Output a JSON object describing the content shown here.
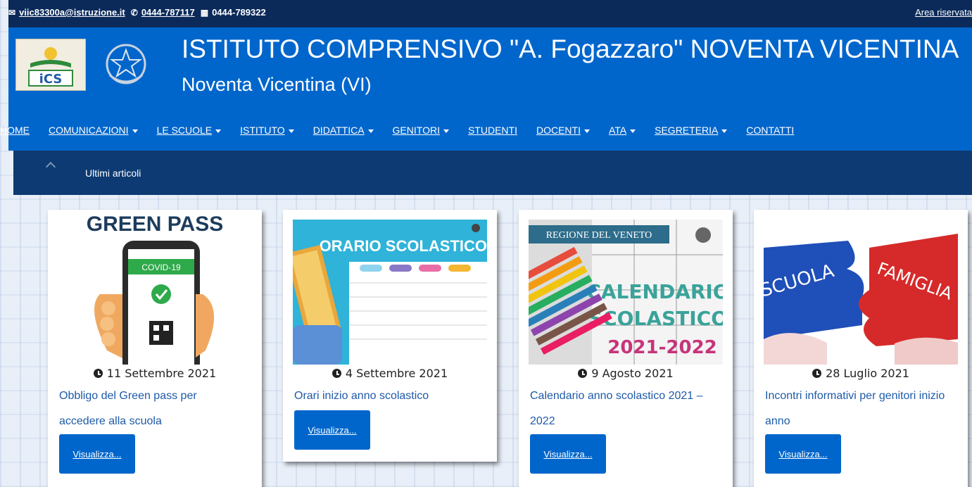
{
  "topbar": {
    "email": "viic83300a@istruzione.it",
    "phone": "0444-787117",
    "fax": "0444-789322",
    "reserved_area": "Area riservata"
  },
  "header": {
    "title": "ISTITUTO COMPRENSIVO \"A. Fogazzaro\" NOVENTA VICENTINA",
    "subtitle": "Noventa Vicentina (VI)",
    "logo_text": "iCS"
  },
  "nav": {
    "items": [
      {
        "label": "HOME",
        "dropdown": false
      },
      {
        "label": "COMUNICAZIONI",
        "dropdown": true
      },
      {
        "label": "LE SCUOLE",
        "dropdown": true
      },
      {
        "label": "ISTITUTO",
        "dropdown": true
      },
      {
        "label": "DIDATTICA",
        "dropdown": true
      },
      {
        "label": "GENITORI",
        "dropdown": true
      },
      {
        "label": "STUDENTI",
        "dropdown": false
      },
      {
        "label": "DOCENTI",
        "dropdown": true
      },
      {
        "label": "ATA",
        "dropdown": true
      },
      {
        "label": "SEGRETERIA",
        "dropdown": true
      },
      {
        "label": "CONTATTI",
        "dropdown": false
      }
    ]
  },
  "ticker": {
    "label": "Ultimi articoli"
  },
  "articles": [
    {
      "date": "11 Settembre 2021",
      "title": "Obbligo del Green pass per accedere alla scuola",
      "button": "Visualizza...",
      "image_text": [
        "GREEN PASS",
        "COVID-19"
      ]
    },
    {
      "date": "4 Settembre 2021",
      "title": "Orari inizio anno scolastico",
      "button": "Visualizza...",
      "image_text": [
        "ORARIO SCOLASTICO"
      ]
    },
    {
      "date": "9 Agosto 2021",
      "title": "Calendario anno scolastico 2021 – 2022",
      "button": "Visualizza...",
      "image_text": [
        "REGIONE DEL VENETO",
        "CALENDARIO",
        "SCOLASTICO",
        "2021-2022"
      ]
    },
    {
      "date": "28 Luglio 2021",
      "title": "Incontri informativi per genitori inizio anno",
      "button": "Visualizza...",
      "image_text": [
        "SCUOLA",
        "FAMIGLIA"
      ]
    }
  ],
  "colors": {
    "topbar": "#0b2a5a",
    "header": "#0066cc",
    "ticker": "#0d3a72",
    "link": "#1e5aa8",
    "button": "#0066cc"
  }
}
